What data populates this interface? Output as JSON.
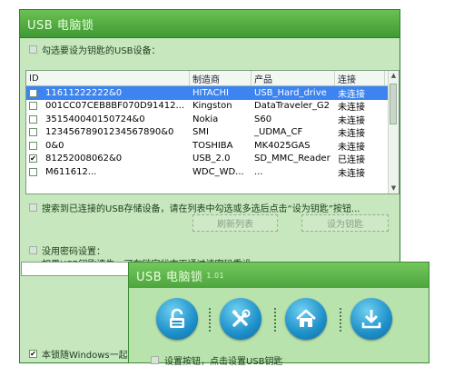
{
  "main_window": {
    "title": "USB 电脑锁",
    "choose_label": "勾选要设为钥匙的USB设备：",
    "table": {
      "headers": [
        "ID",
        "制造商",
        "产品",
        "连接"
      ],
      "rows": [
        {
          "id": "11611222222&0",
          "maker": "HITACHI",
          "product": "USB_Hard_drive",
          "status": "未连接",
          "checked": false,
          "selected": true
        },
        {
          "id": "001CC07CEB8BF070D91412...",
          "maker": "Kingston",
          "product": "DataTraveler_G2",
          "status": "未连接",
          "checked": false,
          "selected": false
        },
        {
          "id": "351540040150724&0",
          "maker": "Nokia",
          "product": "S60",
          "status": "未连接",
          "checked": false,
          "selected": false
        },
        {
          "id": "12345678901234567890&0",
          "maker": "SMI",
          "product": "_UDMA_CF",
          "status": "未连接",
          "checked": false,
          "selected": false
        },
        {
          "id": "0&0",
          "maker": "TOSHIBA",
          "product": "MK4025GAS",
          "status": "未连接",
          "checked": false,
          "selected": false
        },
        {
          "id": "81252008062&0",
          "maker": "USB_2.0",
          "product": "SD_MMC_Reader",
          "status": "已连接",
          "checked": true,
          "selected": false
        },
        {
          "id": "M611612...",
          "maker": "WDC_WD...",
          "product": "...",
          "status": "未连接",
          "checked": false,
          "selected": false
        }
      ]
    },
    "search_label": "搜索到已连接的USB存储设备，请在列表中勾选或多选后点击“设为钥匙”按钮...",
    "refresh_label": "刷新列表",
    "set_key_label": "设为钥匙",
    "password_label": "没用密码设置：",
    "password_hint": "如果USB钥匙遗失，可在锁定状态下通过该密码重设...",
    "startup_label": "本锁随Windows一起启"
  },
  "front_window": {
    "title": "USB 电脑锁",
    "version": "1.01",
    "tools": [
      {
        "name": "unlock",
        "icon": "unlock-icon"
      },
      {
        "name": "settings",
        "icon": "tools-icon"
      },
      {
        "name": "home",
        "icon": "home-icon"
      },
      {
        "name": "download",
        "icon": "download-icon"
      }
    ],
    "bottom_label": "设置按钮，点击设置USB钥匙"
  },
  "colors": {
    "frame_green": "#4fa53f",
    "content_green": "#c7e8be",
    "selection_blue": "#3d84f0",
    "tool_blue": "#1d8fc9"
  }
}
